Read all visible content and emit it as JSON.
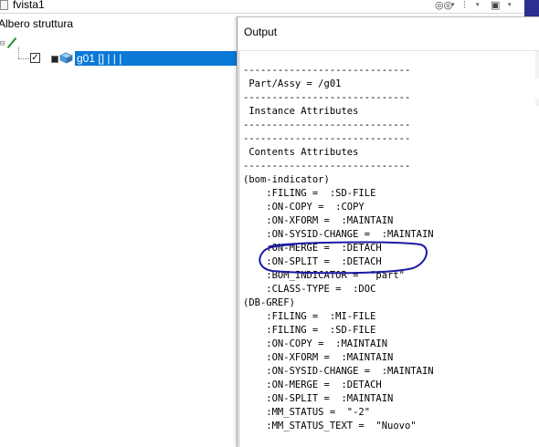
{
  "window": {
    "title": "fvista1"
  },
  "tree": {
    "header": "Albero struttura",
    "item_label": "g01 [] | | |",
    "item_checked": true
  },
  "output": {
    "title": "Output",
    "lines": [
      "-----------------------------",
      " Part/Assy = /g01",
      "-----------------------------",
      " Instance Attributes",
      "-----------------------------",
      "-----------------------------",
      " Contents Attributes",
      "-----------------------------",
      "(bom-indicator)",
      "    :FILING =  :SD-FILE",
      "    :ON-COPY =  :COPY",
      "    :ON-XFORM =  :MAINTAIN",
      "    :ON-SYSID-CHANGE =  :MAINTAIN",
      "    :ON-MERGE =  :DETACH",
      "    :ON-SPLIT =  :DETACH",
      "    :BOM_INDICATOR =  \"part\"",
      "    :CLASS-TYPE =  :DOC",
      "(DB-GREF)",
      "    :FILING =  :MI-FILE",
      "    :FILING =  :SD-FILE",
      "    :ON-COPY =  :MAINTAIN",
      "    :ON-XFORM =  :MAINTAIN",
      "    :ON-SYSID-CHANGE =  :MAINTAIN",
      "    :ON-MERGE =  :DETACH",
      "    :ON-SPLIT =  :MAINTAIN",
      "    :MM_STATUS =  \"-2\"",
      "    :MM_STATUS_TEXT =  \"Nuovo\""
    ]
  },
  "icons": {
    "window": "document-icon",
    "binoculars": "binoculars-icon",
    "filter": "filter-icon",
    "view": "view-options-icon",
    "pencil": "edit-pencil-icon",
    "part": "part-3d-icon",
    "disk": "save-disk-icon"
  },
  "colors": {
    "selection": "#0a78d7",
    "annotation": "#1a1aa6",
    "accent": "#2b2f8f"
  }
}
